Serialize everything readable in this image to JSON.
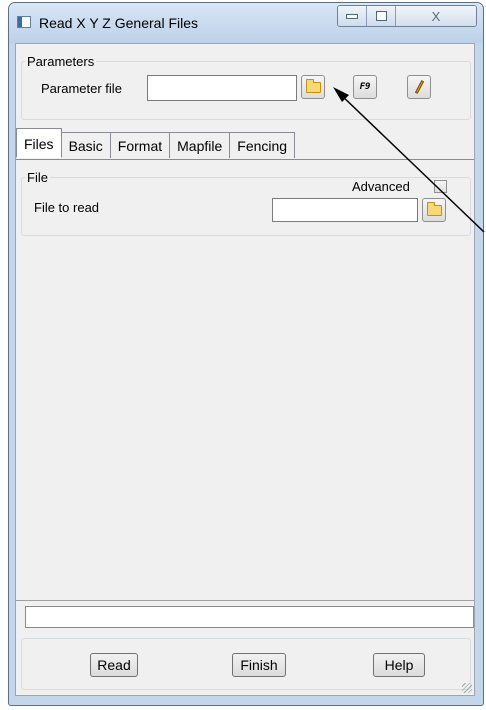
{
  "window": {
    "title": "Read X Y Z General Files",
    "close_glyph": "X"
  },
  "parameters": {
    "legend": "Parameters",
    "parameter_file_label": "Parameter file",
    "parameter_file_value": "",
    "f9_label": "F9"
  },
  "tabs": [
    {
      "label": "Files"
    },
    {
      "label": "Basic"
    },
    {
      "label": "Format"
    },
    {
      "label": "Mapfile"
    },
    {
      "label": "Fencing"
    }
  ],
  "files_tab": {
    "group_legend": "File",
    "advanced_label": "Advanced",
    "advanced_checked": false,
    "file_to_read_label": "File to read",
    "file_to_read_value": ""
  },
  "status_text": "",
  "buttons": {
    "read": "Read",
    "finish": "Finish",
    "help": "Help"
  },
  "colors": {
    "title_bar": "#c4d6ea",
    "client": "#f0f0f0",
    "folder": "#f8d775"
  }
}
